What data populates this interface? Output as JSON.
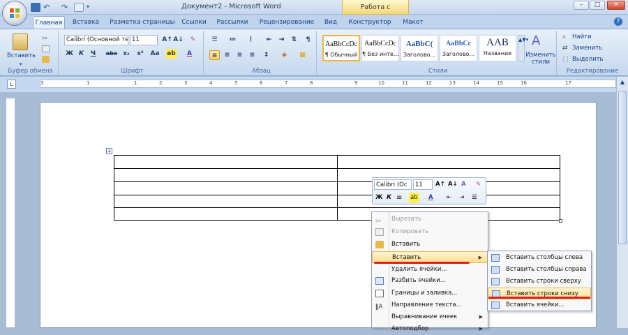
{
  "window": {
    "title": "Документ2 - Microsoft Word",
    "context_tab": "Работа с таблицами",
    "min": "–",
    "max": "□",
    "close": "✕"
  },
  "tabs": [
    "Главная",
    "Вставка",
    "Разметка страницы",
    "Ссылки",
    "Рассылки",
    "Рецензирование",
    "Вид",
    "Конструктор",
    "Макет"
  ],
  "ribbon": {
    "clipboard": {
      "paste": "Вставить",
      "label": "Буфер обмена"
    },
    "font": {
      "name": "Calibri (Основной те",
      "size": "11",
      "label": "Шрифт",
      "bold": "Ж",
      "italic": "К",
      "underline": "Ч",
      "strike": "abe",
      "sub": "x₂",
      "sup": "x²",
      "case": "Aa"
    },
    "paragraph": {
      "label": "Абзац"
    },
    "styles": {
      "label": "Стили",
      "items": [
        {
          "preview": "AaBbCcDc",
          "name": "¶ Обычный"
        },
        {
          "preview": "AaBbCcDc",
          "name": "¶ Без инте..."
        },
        {
          "preview": "AaBbC(",
          "name": "Заголово..."
        },
        {
          "preview": "AaBbCc",
          "name": "Заголово..."
        },
        {
          "preview": "AAB",
          "name": "Название"
        }
      ],
      "change": "Изменить стили"
    },
    "editing": {
      "find": "Найти",
      "replace": "Заменить",
      "select": "Выделить",
      "label": "Редактирование"
    }
  },
  "ruler": [
    "3",
    "1",
    "1",
    "2",
    "3",
    "4",
    "5",
    "6",
    "7",
    "8",
    "9",
    "10",
    "11",
    "12",
    "13",
    "14",
    "15",
    "16",
    "17"
  ],
  "mini_toolbar": {
    "font": "Calibri (Ос",
    "size": "11",
    "bold": "Ж",
    "italic": "К",
    "color_a": "A"
  },
  "context_menu": [
    {
      "label": "Вырезать",
      "disabled": true
    },
    {
      "label": "Копировать",
      "disabled": true
    },
    {
      "label": "Вставить",
      "disabled": false
    },
    {
      "label": "Вставить",
      "disabled": false,
      "submenu": true,
      "highlighted": true
    },
    {
      "label": "Удалить ячейки...",
      "disabled": false
    },
    {
      "label": "Разбить ячейки...",
      "disabled": false
    },
    {
      "label": "Границы и заливка...",
      "disabled": false
    },
    {
      "label": "Направление текста...",
      "disabled": false
    },
    {
      "label": "Выравнивание ячеек",
      "disabled": false,
      "submenu": true
    },
    {
      "label": "Автоподбор",
      "disabled": false,
      "submenu": true
    }
  ],
  "submenu": [
    {
      "label": "Вставить столбцы слева"
    },
    {
      "label": "Вставить столбцы справа"
    },
    {
      "label": "Вставить строки сверху"
    },
    {
      "label": "Вставить строки снизу",
      "highlighted": true
    },
    {
      "label": "Вставить ячейки..."
    }
  ],
  "colors": {
    "highlight": "#ffdf8f",
    "annotation": "#e02020",
    "ribbon": "#d0dff1"
  }
}
